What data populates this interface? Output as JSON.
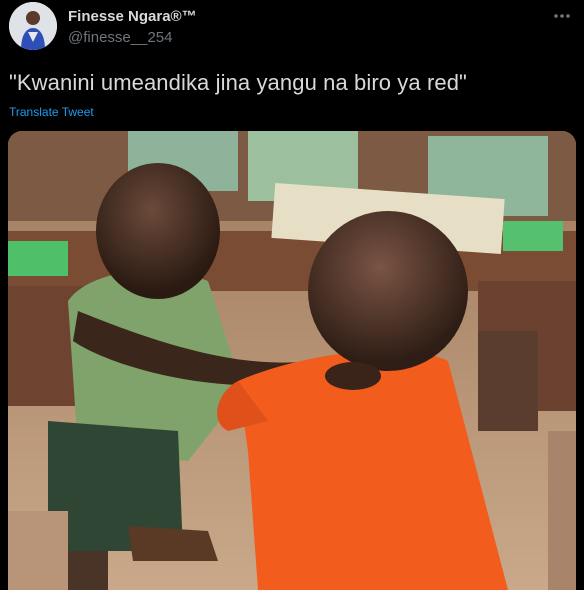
{
  "author": {
    "display_name": "Finesse Ngara®™",
    "handle": "@finesse__254",
    "avatar_icon": "profile-avatar"
  },
  "tweet": {
    "text": "\"Kwanini umeandika jina yangu na biro ya red\"",
    "translate_label": "Translate Tweet"
  },
  "actions": {
    "more_icon": "more-options-icon"
  },
  "media": {
    "kind": "photo"
  },
  "colors": {
    "background": "#000000",
    "primary_text": "#d9d9d9",
    "secondary_text": "#6e767d",
    "link": "#1d9bf0"
  }
}
